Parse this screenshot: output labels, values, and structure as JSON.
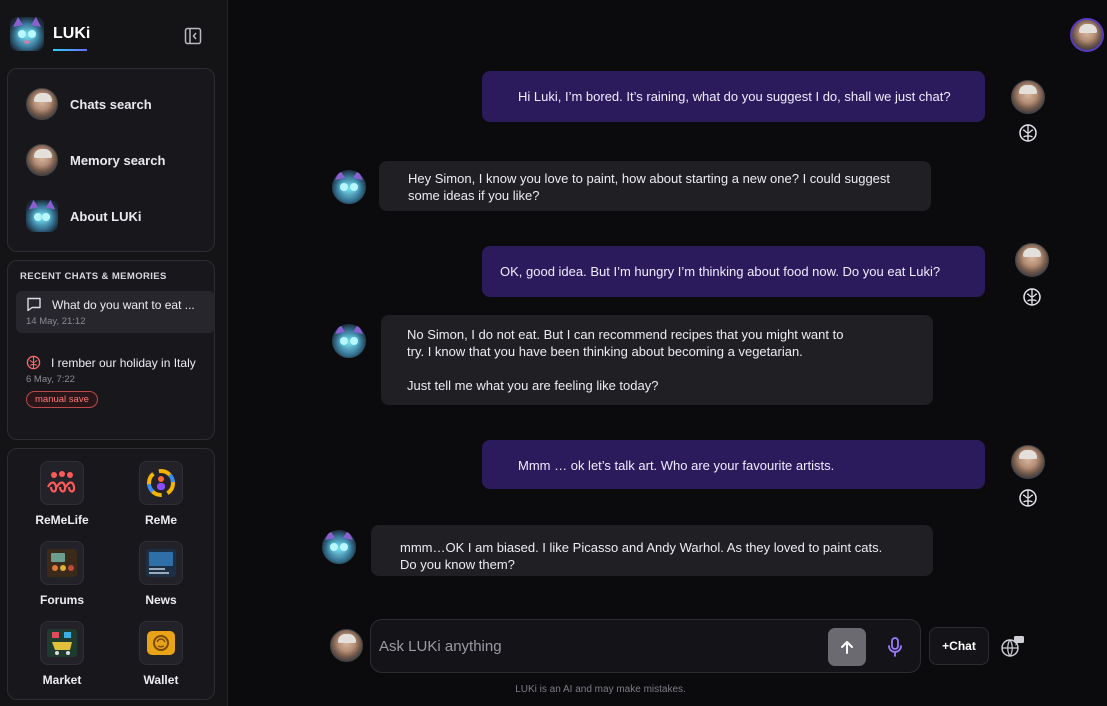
{
  "brand": {
    "name": "LUKi"
  },
  "nav": [
    {
      "label": "Chats search",
      "icon": "user-avatar"
    },
    {
      "label": "Memory search",
      "icon": "user-avatar"
    },
    {
      "label": "About LUKi",
      "icon": "luki-cat-avatar"
    }
  ],
  "recent": {
    "title": "RECENT CHATS & MEMORIES",
    "items": [
      {
        "title": "What do you want to eat ...",
        "date": "14 May, 21:12",
        "icon": "chat-bubble-icon"
      },
      {
        "title": "I rember our holiday in Italy",
        "date": "6 May, 7:22",
        "icon": "brain-icon",
        "badge": "manual save"
      }
    ]
  },
  "apps": [
    {
      "label": "ReMeLife"
    },
    {
      "label": "ReMe"
    },
    {
      "label": "Forums"
    },
    {
      "label": "News"
    },
    {
      "label": "Market"
    },
    {
      "label": "Wallet"
    }
  ],
  "messages": [
    {
      "role": "user",
      "text": "Hi Luki, I’m bored. It’s raining, what do you suggest I do, shall we just chat?"
    },
    {
      "role": "bot",
      "text": "Hey Simon, I know you love to paint, how about starting a new one? I could suggest some ideas if you like?"
    },
    {
      "role": "user",
      "text": "OK, good idea. But I’m hungry I’m thinking about food now. Do you eat Luki?"
    },
    {
      "role": "bot",
      "line1": "No Simon, I do not eat. But I can recommend recipes that you might want to try. I know that you have been thinking about becoming a vegetarian.",
      "line2": "Just tell me what you are feeling like today?"
    },
    {
      "role": "user",
      "text": "Mmm … ok let’s talk art. Who are your favourite artists."
    },
    {
      "role": "bot",
      "text": "mmm…OK I am biased. I like Picasso and Andy Warhol. As they loved to paint cats. Do you know them?"
    }
  ],
  "composer": {
    "placeholder": "Ask LUKi anything",
    "new_chat_label": "+Chat",
    "disclaimer": "LUKi is an AI and may make mistakes."
  },
  "colors": {
    "user_bubble": "#2b1b5c",
    "bot_bubble": "#1f1f24",
    "accent": "#8a6cff",
    "badge": "#ff7a7a"
  }
}
